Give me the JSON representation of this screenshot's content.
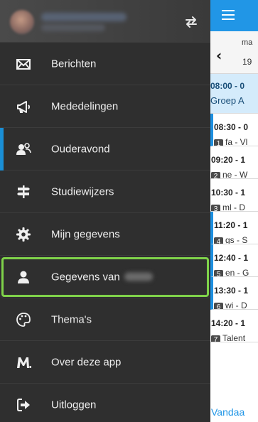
{
  "drawer": {
    "items": [
      {
        "label": "Berichten",
        "icon": "envelope-icon"
      },
      {
        "label": "Mededelingen",
        "icon": "megaphone-icon"
      },
      {
        "label": "Ouderavond",
        "icon": "parents-meeting-icon"
      },
      {
        "label": "Studiewijzers",
        "icon": "signpost-icon"
      },
      {
        "label": "Mijn gegevens",
        "icon": "gear-icon"
      },
      {
        "label": "Gegevens van",
        "icon": "user-icon"
      },
      {
        "label": "Thema's",
        "icon": "palette-icon"
      },
      {
        "label": "Over deze app",
        "icon": "app-logo-icon"
      },
      {
        "label": "Uitloggen",
        "icon": "logout-icon"
      }
    ],
    "active_item": "Ouderavond",
    "highlighted_item": "Gegevens van"
  },
  "schedule": {
    "day_of_week": "ma",
    "day_number": "19",
    "lessons": [
      {
        "time": "08:00 - 0",
        "subject": "Groep A",
        "number": ""
      },
      {
        "time": "08:30 - 0",
        "subject": "fa - Vl",
        "number": "1"
      },
      {
        "time": "09:20 - 1",
        "subject": "ne - W",
        "number": "2"
      },
      {
        "time": "10:30 - 1",
        "subject": "ml - D",
        "number": "3"
      },
      {
        "time": "11:20 - 1",
        "subject": "gs - S",
        "number": "4"
      },
      {
        "time": "12:40 - 1",
        "subject": "en - G",
        "number": "5"
      },
      {
        "time": "13:30 - 1",
        "subject": "wi - D",
        "number": "6"
      },
      {
        "time": "14:20 - 1",
        "subject": "Talent",
        "number": "7"
      }
    ],
    "today_label": "Vandaa"
  },
  "colors": {
    "drawer_bg": "#2f2f2f",
    "accent_blue": "#2196e6",
    "active_indicator": "#1a8fd6",
    "highlight_outline": "#7fd24a",
    "first_lesson_bg": "#d4ebfb"
  }
}
